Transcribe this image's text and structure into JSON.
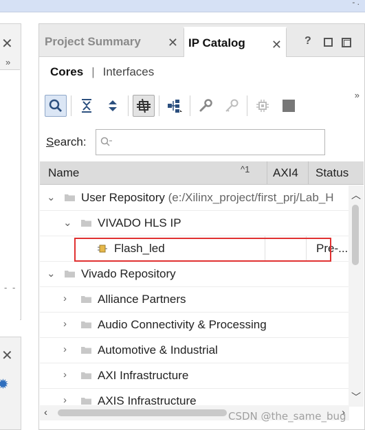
{
  "tabs": [
    {
      "label": "Project Summary",
      "active": false
    },
    {
      "label": "IP Catalog",
      "active": true
    }
  ],
  "window_controls": {
    "help": "?"
  },
  "subtabs": {
    "active": "Cores",
    "separator": "|",
    "inactive": "Interfaces"
  },
  "search": {
    "label_underlined": "S",
    "label_rest": "earch:",
    "value": "",
    "placeholder": ""
  },
  "table": {
    "columns": [
      "Name",
      "AXI4",
      "Status"
    ],
    "sort_indicator": "^1"
  },
  "tree_rows": [
    {
      "level": 0,
      "expanded": true,
      "type": "folder",
      "label": "User Repository",
      "path": "(e:/Xilinx_project/first_prj/Lab_H",
      "status": ""
    },
    {
      "level": 1,
      "expanded": true,
      "type": "folder",
      "label": "VIVADO HLS IP",
      "status": ""
    },
    {
      "level": 2,
      "type": "ip",
      "label": "Flash_led",
      "status": "Pre-..."
    },
    {
      "level": 0,
      "expanded": true,
      "type": "folder",
      "label": "Vivado Repository",
      "status": ""
    },
    {
      "level": 1,
      "expanded": false,
      "type": "folder",
      "label": "Alliance Partners",
      "status": ""
    },
    {
      "level": 1,
      "expanded": false,
      "type": "folder",
      "label": "Audio Connectivity & Processing",
      "status": ""
    },
    {
      "level": 1,
      "expanded": false,
      "type": "folder",
      "label": "Automotive & Industrial",
      "status": ""
    },
    {
      "level": 1,
      "expanded": false,
      "type": "folder",
      "label": "AXI Infrastructure",
      "status": ""
    },
    {
      "level": 1,
      "expanded": false,
      "type": "folder",
      "label": "AXIS Infrastructure",
      "status": ""
    }
  ],
  "watermark": "CSDN @the_same_bug",
  "colors": {
    "highlight": "#e03030",
    "selected_tab_bg": "#ffffff",
    "header_bg": "#dcdcdc"
  }
}
